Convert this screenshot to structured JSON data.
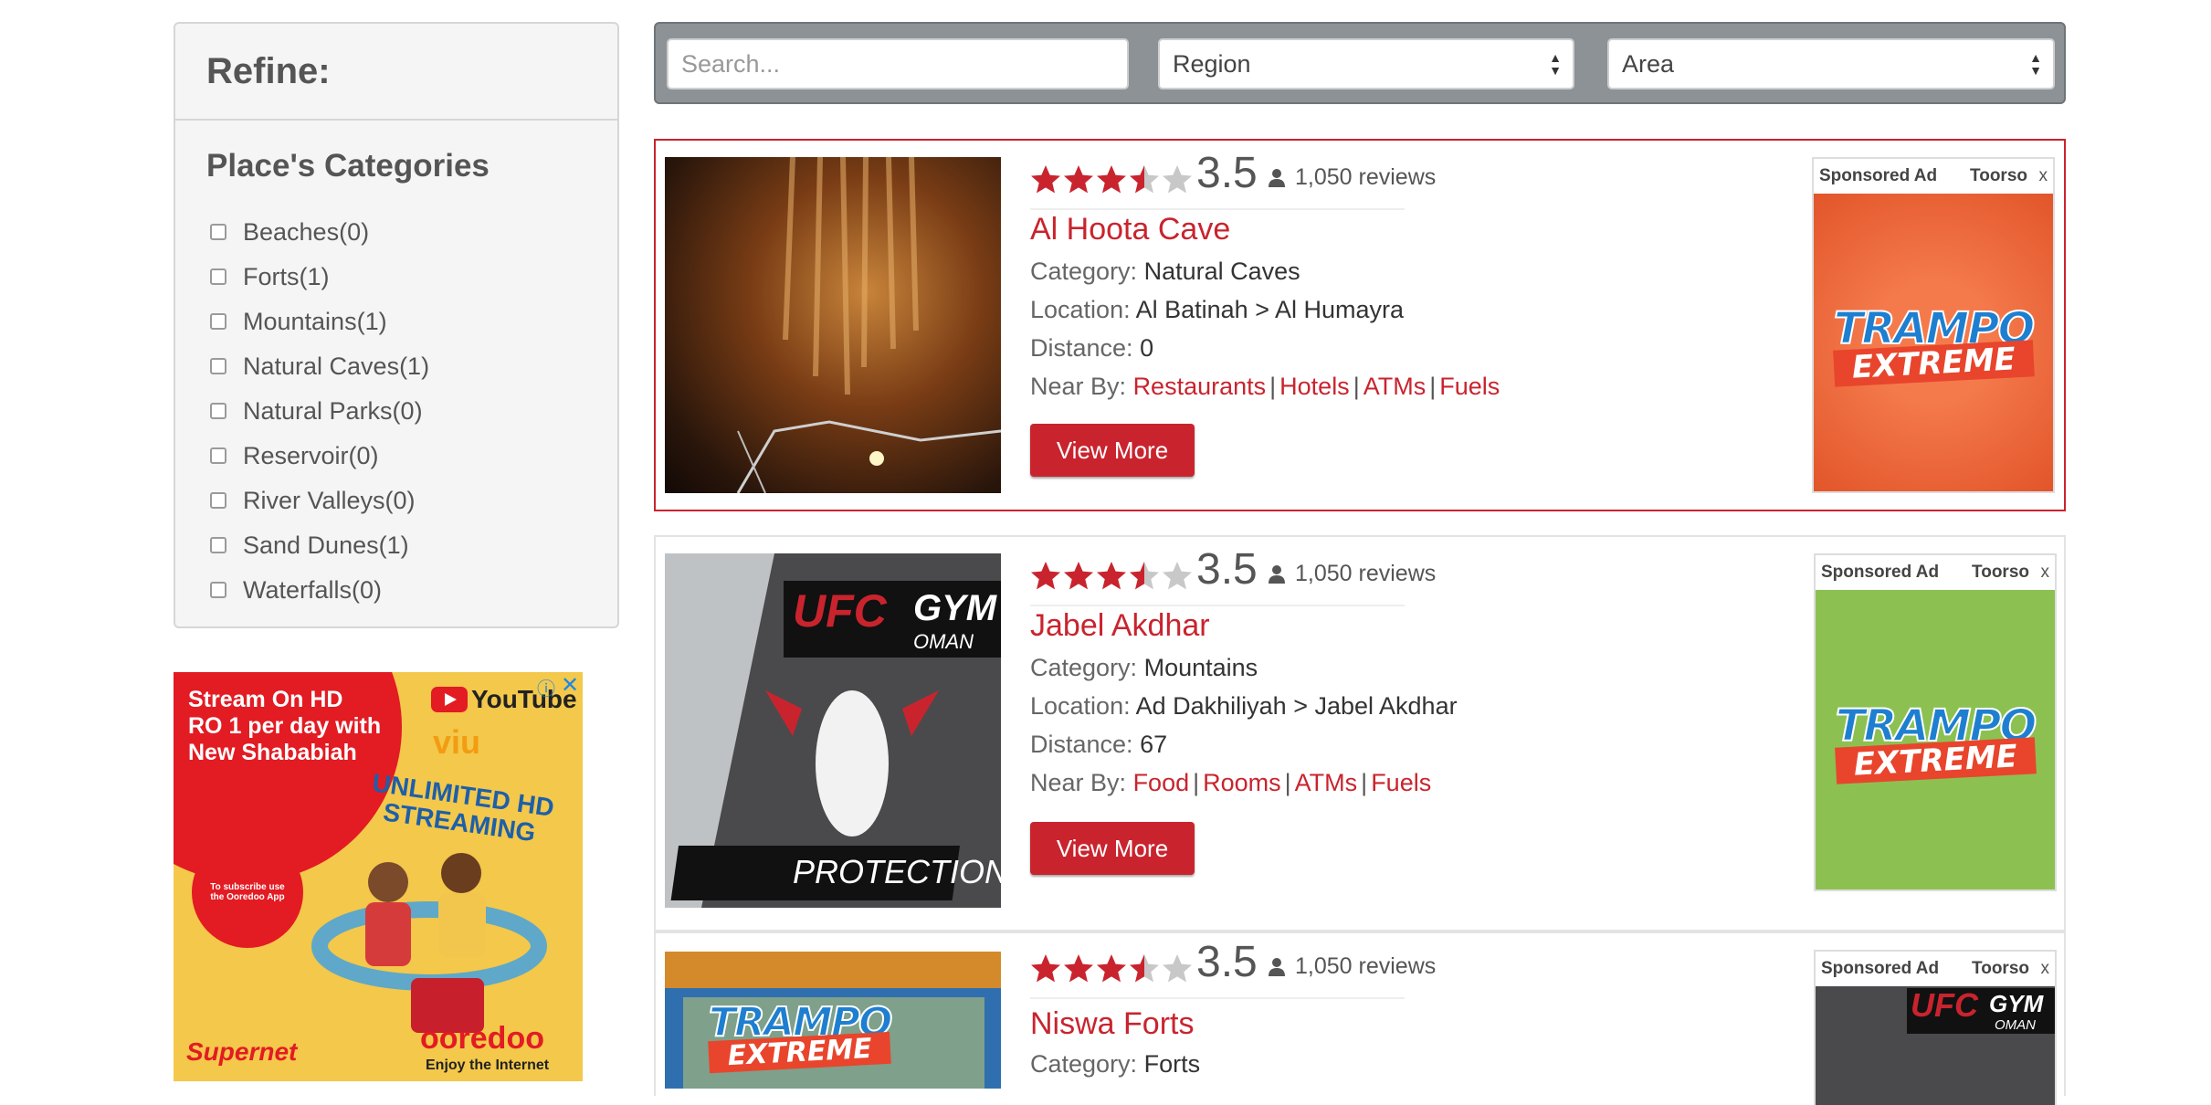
{
  "sidebar": {
    "title": "Refine:",
    "categories_title": "Place's Categories",
    "categories": [
      {
        "label": "Beaches(0)"
      },
      {
        "label": "Forts(1)"
      },
      {
        "label": "Mountains(1)"
      },
      {
        "label": "Natural Caves(1)"
      },
      {
        "label": "Natural Parks(0)"
      },
      {
        "label": "Reservoir(0)"
      },
      {
        "label": "River Valleys(0)"
      },
      {
        "label": "Sand Dunes(1)"
      },
      {
        "label": "Waterfalls(0)"
      }
    ],
    "ad": {
      "line1": "Stream On HD",
      "line2": "RO 1 per day with",
      "line3": "New Shababiah",
      "youtube": "YouTube",
      "viu": "viu",
      "unlimited": "UNLIMITED HD STREAMING",
      "subscribe": "To subscribe use the Ooredoo App",
      "supernet": "Supernet",
      "ooredoo": "ooredoo",
      "tagline": "Enjoy the Internet"
    }
  },
  "search": {
    "placeholder": "Search...",
    "region": "Region",
    "area": "Area"
  },
  "listings": [
    {
      "rating": "3.5",
      "rating_value": 3.5,
      "reviews": "1,050 reviews",
      "title": "Al Hoota Cave",
      "category_label": "Category:",
      "category": "Natural Caves",
      "location_label": "Location:",
      "location": "Al Batinah > Al Humayra",
      "distance_label": "Distance:",
      "distance": "0",
      "nearby_label": "Near By:",
      "nearby": [
        "Restaurants",
        "Hotels",
        "ATMs",
        "Fuels"
      ],
      "button": "View More",
      "ad": {
        "sponsored": "Sponsored Ad",
        "brand": "Toorso",
        "close": "x",
        "logo_top": "TRAMPO",
        "logo_bottom": "EXTREME",
        "bg": "#ee6a3c"
      }
    },
    {
      "rating": "3.5",
      "rating_value": 3.5,
      "reviews": "1,050 reviews",
      "title": "Jabel Akdhar",
      "category_label": "Category:",
      "category": "Mountains",
      "location_label": "Location:",
      "location": "Ad Dakhiliyah > Jabel Akdhar",
      "distance_label": "Distance:",
      "distance": "67",
      "nearby_label": "Near By:",
      "nearby": [
        "Food",
        "Rooms",
        "ATMs",
        "Fuels"
      ],
      "button": "View More",
      "thumb": {
        "brand": "UFC",
        "sub": "GYM",
        "city": "OMAN",
        "caption": "PROTECTION."
      },
      "ad": {
        "sponsored": "Sponsored Ad",
        "brand": "Toorso",
        "close": "x",
        "logo_top": "TRAMPO",
        "logo_bottom": "EXTREME",
        "bg": "#8cc152"
      }
    },
    {
      "rating": "3.5",
      "rating_value": 3.5,
      "reviews": "1,050 reviews",
      "title": "Niswa Forts",
      "category_label": "Category:",
      "category": "Forts",
      "thumb": {
        "logo_top": "TRAMPO",
        "logo_bottom": "EXTREME"
      },
      "ad": {
        "sponsored": "Sponsored Ad",
        "brand": "Toorso",
        "close": "x",
        "ufc": "UFC",
        "gym": "GYM",
        "city": "OMAN"
      }
    }
  ],
  "colors": {
    "accent": "#c9242e",
    "star_off": "#c8c8c8"
  }
}
